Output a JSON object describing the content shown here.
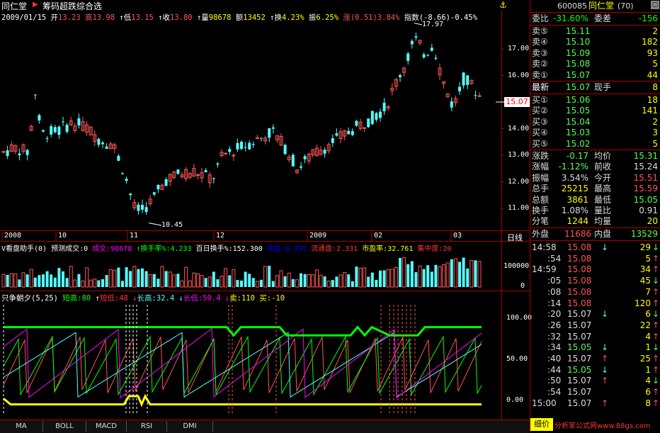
{
  "colors": {
    "up": "#ff5555",
    "down": "#54ffff",
    "frame": "#aa0000",
    "yellow": "#ffff00",
    "green": "#00ff00",
    "magenta": "#ff00ff",
    "white": "#ffffff"
  },
  "title": {
    "stock_name": "同仁堂",
    "mode": "筹码超跌综合选"
  },
  "quote_line": {
    "date": "2009/01/15",
    "open_label": "开",
    "open": "13.23",
    "high_label": "高",
    "high": "13.98",
    "low_label": "低",
    "low": "13.15",
    "close_label": "收",
    "close": "13.80",
    "vol_label": "量",
    "vol": "98678",
    "amt_label": "额",
    "amt": "13452",
    "turn_label": "换",
    "turn": "4.23%",
    "amp_label": "振",
    "amp": "6.25%",
    "chg_label": "涨",
    "chg": "(0.51)",
    "chgpct": "3.84%",
    "index_label": "指数",
    "index": "(-8.66)",
    "indexpct": "-0.45%"
  },
  "price_axis": [
    "17.00",
    "16.00",
    "15.00",
    "14.00",
    "13.00",
    "12.00",
    "11.00"
  ],
  "price_current": "15.07",
  "price_annot": {
    "high": "17.97",
    "low": "10.45"
  },
  "date_axis": [
    "2008",
    "10",
    "11",
    "12",
    "2009",
    "02",
    "03"
  ],
  "date_axis_right": "日线",
  "vol_line": {
    "name": "V看盘助手(0)",
    "predict_label": "预测成交:",
    "predict": "0",
    "vol_label": "成交:",
    "vol": "98678",
    "turn_label": "换手率%:",
    "turn": "4.233",
    "turn100_label": "百日换手%:",
    "turn100": "152.300",
    "ret_label": "收益:",
    "ret": "0.345",
    "float_label": "流通盘:",
    "float": "2.331",
    "pe_label": "市盈率:",
    "pe": "32.761",
    "conc_label": "集中度:",
    "conc": "20"
  },
  "vol_axis": [
    "100000",
    "0"
  ],
  "ind_line": {
    "name": "只争朝夕(5,25)",
    "short_high_label": "短高:",
    "short_high": "80",
    "short_low_label": "短低:",
    "short_low": "48",
    "long_high_label": "长高:",
    "long_high": "32.4",
    "long_low_label": "长低:",
    "long_low": "50.4",
    "sell_label": "卖:",
    "sell": "110",
    "buy_label": "买:",
    "buy": "-10"
  },
  "ind_axis": [
    "100.00",
    "50.00",
    "0.00"
  ],
  "tabs": [
    "MA",
    "BOLL",
    "MACD",
    "RSI",
    "DMI"
  ],
  "panel": {
    "code": "600085",
    "name": "同仁堂",
    "count": "(70)",
    "ratio_label": "委比",
    "ratio": "-31.60%",
    "diff_label": "委差",
    "diff": "-156",
    "asks": [
      {
        "label": "卖⑤",
        "price": "15.11",
        "vol": "2"
      },
      {
        "label": "卖④",
        "price": "15.10",
        "vol": "182"
      },
      {
        "label": "卖③",
        "price": "15.09",
        "vol": "93"
      },
      {
        "label": "卖②",
        "price": "15.08",
        "vol": "5"
      },
      {
        "label": "卖①",
        "price": "15.07",
        "vol": "44"
      }
    ],
    "last_label": "最新",
    "last": "15.07",
    "hand_label": "现手",
    "hand": "8",
    "bids": [
      {
        "label": "买①",
        "price": "15.06",
        "vol": "18"
      },
      {
        "label": "买②",
        "price": "15.05",
        "vol": "141"
      },
      {
        "label": "买③",
        "price": "15.04",
        "vol": "2"
      },
      {
        "label": "买④",
        "price": "15.03",
        "vol": "3"
      },
      {
        "label": "买⑤",
        "price": "15.02",
        "vol": "5"
      }
    ],
    "stats": [
      {
        "l1": "涨跌",
        "v1": "-0.17",
        "l2": "均价",
        "v2": "15.31"
      },
      {
        "l1": "涨幅",
        "v1": "-1.12%",
        "l2": "前收",
        "v2": "15.24"
      },
      {
        "l1": "振幅",
        "v1": "3.54%",
        "l2": "今开",
        "v2": "15.51"
      },
      {
        "l1": "总手",
        "v1": "25215",
        "l2": "最高",
        "v2": "15.59"
      },
      {
        "l1": "总额",
        "v1": "3861",
        "l2": "最低",
        "v2": "15.05"
      },
      {
        "l1": "换手",
        "v1": "1.08%",
        "l2": "量比",
        "v2": "0.91"
      },
      {
        "l1": "分笔",
        "v1": "1244",
        "l2": "均量",
        "v2": "20"
      }
    ],
    "outer_label": "外盘",
    "outer": "11686",
    "inner_label": "内盘",
    "inner": "13529",
    "ticks": [
      {
        "t": "14:58",
        "p": "15.08",
        "a": "↓",
        "v": "29"
      },
      {
        "t": ":54",
        "p": "15.08",
        "a": "",
        "v": "5"
      },
      {
        "t": "14:59",
        "p": "15.08",
        "a": "",
        "v": "34"
      },
      {
        "t": ":05",
        "p": "15.08",
        "a": "",
        "v": "45"
      },
      {
        "t": ":08",
        "p": "15.08",
        "a": "",
        "v": "7"
      },
      {
        "t": ":14",
        "p": "15.08",
        "a": "",
        "v": "120"
      },
      {
        "t": ":20",
        "p": "15.07",
        "a": "↓",
        "v": "6"
      },
      {
        "t": ":26",
        "p": "15.07",
        "a": "",
        "v": "22"
      },
      {
        "t": ":32",
        "p": "15.07",
        "a": "",
        "v": "4"
      },
      {
        "t": ":34",
        "p": "15.05",
        "a": "↓",
        "v": "1"
      },
      {
        "t": ":40",
        "p": "15.07",
        "a": "↑",
        "v": "25"
      },
      {
        "t": ":44",
        "p": "15.05",
        "a": "↓",
        "v": "1"
      },
      {
        "t": ":50",
        "p": "15.07",
        "a": "↑",
        "v": "4"
      },
      {
        "t": ":54",
        "p": "15.07",
        "a": "",
        "v": "6"
      },
      {
        "t": "15:00",
        "p": "15.07",
        "a": "↑",
        "v": "8"
      }
    ],
    "footer_label": "细价",
    "footer_site": "分析家公式网www.88gs.com"
  }
}
